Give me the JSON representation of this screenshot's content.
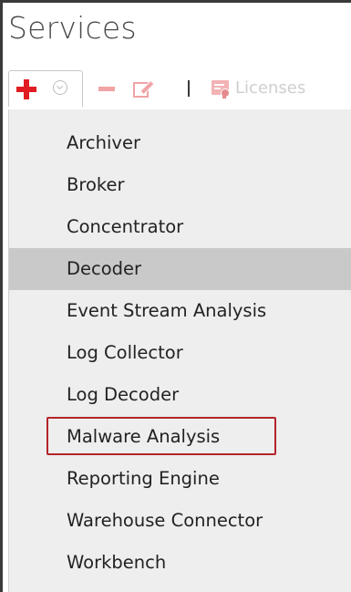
{
  "page": {
    "title": "Services"
  },
  "toolbar": {
    "add_icon": "plus-icon",
    "dropdown_icon": "chevron-down-icon",
    "remove_icon": "minus-icon",
    "edit_icon": "edit-icon",
    "licenses_icon": "license-icon",
    "licenses_label": "Licenses"
  },
  "menu": {
    "items": [
      {
        "label": "Archiver",
        "selected": false,
        "highlighted": false
      },
      {
        "label": "Broker",
        "selected": false,
        "highlighted": false
      },
      {
        "label": "Concentrator",
        "selected": false,
        "highlighted": false
      },
      {
        "label": "Decoder",
        "selected": true,
        "highlighted": false
      },
      {
        "label": "Event Stream Analysis",
        "selected": false,
        "highlighted": false
      },
      {
        "label": "Log Collector",
        "selected": false,
        "highlighted": false
      },
      {
        "label": "Log Decoder",
        "selected": false,
        "highlighted": false
      },
      {
        "label": "Malware Analysis",
        "selected": false,
        "highlighted": true
      },
      {
        "label": "Reporting Engine",
        "selected": false,
        "highlighted": false
      },
      {
        "label": "Warehouse Connector",
        "selected": false,
        "highlighted": false
      },
      {
        "label": "Workbench",
        "selected": false,
        "highlighted": false
      }
    ]
  },
  "colors": {
    "add_red": "#e01b22",
    "disabled_red": "#f1a3a6",
    "menu_background": "#eeeeee",
    "selected_row": "#c9c9c9",
    "callout_border": "#b3242b"
  }
}
